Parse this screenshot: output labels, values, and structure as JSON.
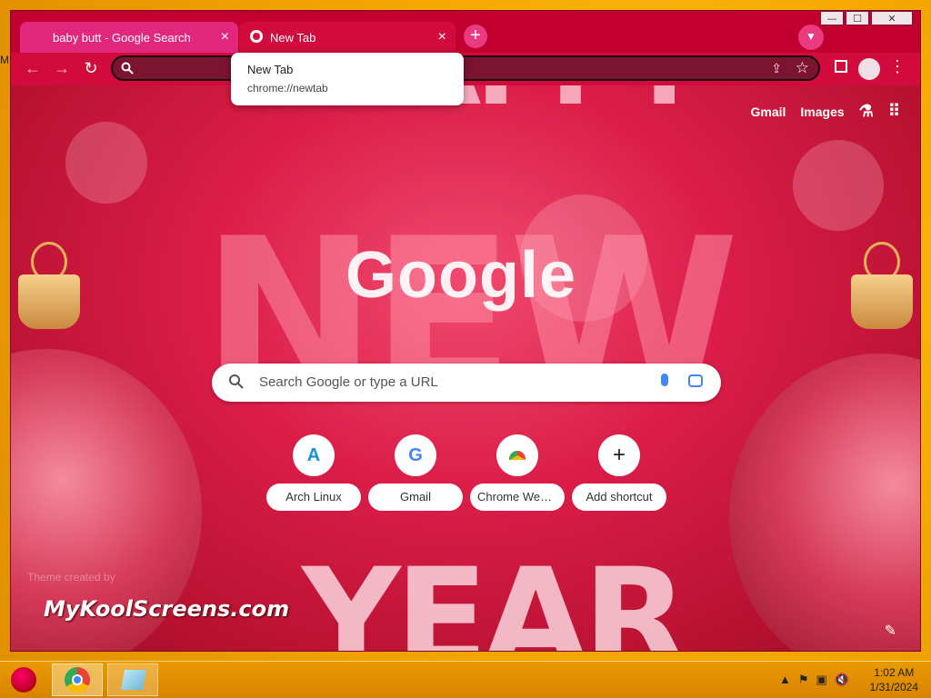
{
  "window": {
    "tabs": [
      {
        "title": "baby butt - Google Search"
      },
      {
        "title": "New Tab"
      }
    ],
    "controls": {
      "minimize": "—",
      "maximize": "☐",
      "close": "✕"
    }
  },
  "tooltip": {
    "title": "New Tab",
    "url": "chrome://newtab"
  },
  "ntp": {
    "links": {
      "gmail": "Gmail",
      "images": "Images"
    },
    "logo": "Google",
    "search_placeholder": "Search Google or type a URL",
    "shortcuts": [
      {
        "label": "Arch Linux",
        "glyph": "A"
      },
      {
        "label": "Gmail",
        "glyph": "G"
      },
      {
        "label": "Chrome Web ...",
        "glyph": ""
      },
      {
        "label": "Add shortcut",
        "glyph": "+"
      }
    ],
    "theme_credit": "Theme created by",
    "watermark": "MyKoolScreens.com",
    "background_lettering": {
      "top": "HAPPY",
      "middle": "NEW",
      "bottom": "YEAR"
    }
  },
  "taskbar": {
    "time": "1:02 AM",
    "date": "1/31/2024"
  },
  "colors": {
    "tab_active": "#d10c3c",
    "tab_inactive": "#e2287e",
    "frame": "#c2002f",
    "accent_blue": "#4285f4"
  }
}
